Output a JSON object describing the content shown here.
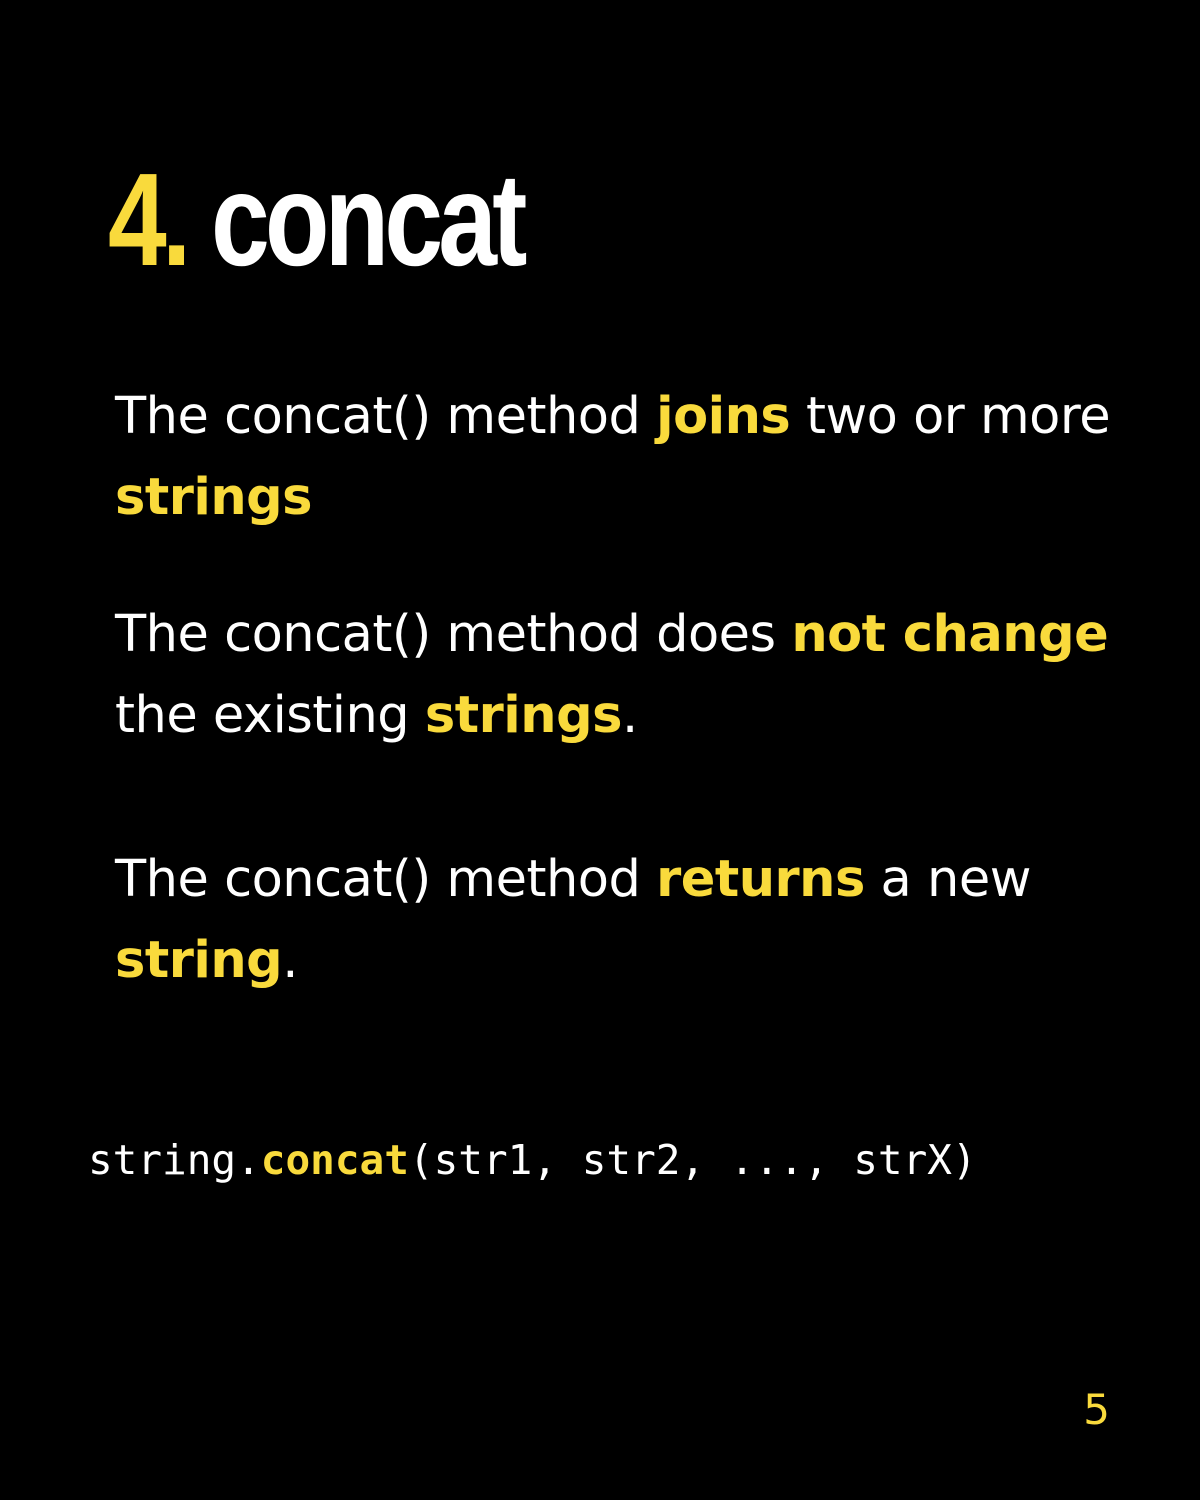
{
  "title": {
    "number": "4.",
    "name": "concat"
  },
  "paragraphs": [
    {
      "parts": [
        {
          "text": "The concat() method ",
          "highlight": false
        },
        {
          "text": "joins",
          "highlight": true
        },
        {
          "text": " two or more ",
          "highlight": false
        },
        {
          "text": "strings",
          "highlight": true
        }
      ]
    },
    {
      "parts": [
        {
          "text": "The concat() method does ",
          "highlight": false
        },
        {
          "text": "not change",
          "highlight": true
        },
        {
          "text": " the existing ",
          "highlight": false
        },
        {
          "text": "strings",
          "highlight": true
        },
        {
          "text": ".",
          "highlight": false
        }
      ]
    },
    {
      "parts": [
        {
          "text": "The concat() method ",
          "highlight": false
        },
        {
          "text": "returns",
          "highlight": true
        },
        {
          "text": " a new ",
          "highlight": false
        },
        {
          "text": "string",
          "highlight": true
        },
        {
          "text": ".",
          "highlight": false
        }
      ]
    }
  ],
  "syntax": {
    "object": "string.",
    "method": "concat",
    "args": "(str1, str2, ..., strX)"
  },
  "page_number": "5",
  "colors": {
    "background": "#000000",
    "accent": "#f9da3c",
    "text": "#ffffff"
  }
}
